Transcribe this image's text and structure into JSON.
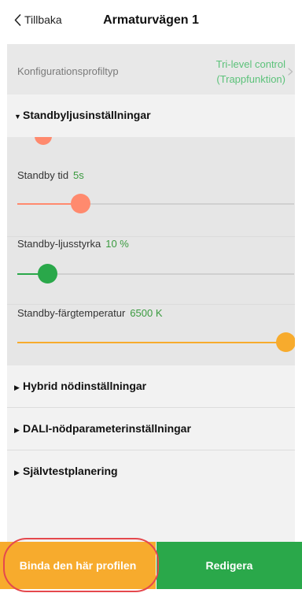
{
  "header": {
    "back_label": "Tillbaka",
    "title": "Armaturvägen 1"
  },
  "profile_type": {
    "label": "Konfigurationsprofiltyp",
    "value_line1": "Tri-level control",
    "value_line2": "(Trappfunktion)"
  },
  "standby_section": {
    "title": "Standbyljusinställningar",
    "expanded": true,
    "sliders": [
      {
        "label": "Standby tid",
        "value": "5s",
        "fraction": 0.23,
        "color": "#ff8a6e"
      },
      {
        "label": "Standby-ljusstyrka",
        "value": "10 %",
        "fraction": 0.11,
        "color": "#2aa84a"
      },
      {
        "label": "Standby-färgtemperatur",
        "value": "6500 K",
        "fraction": 1.0,
        "color": "#f7ab2d"
      }
    ]
  },
  "collapsed_sections": [
    {
      "title": "Hybrid nödinställningar"
    },
    {
      "title": "DALI-nödparameterinställningar"
    },
    {
      "title": "Självtestplanering"
    }
  ],
  "footer": {
    "bind_label": "Binda den här profilen",
    "edit_label": "Redigera"
  },
  "colors": {
    "accent_green": "#2aa84a",
    "accent_orange": "#f7ab2d",
    "accent_coral": "#ff8a6e",
    "highlight_red": "#e5484d"
  }
}
